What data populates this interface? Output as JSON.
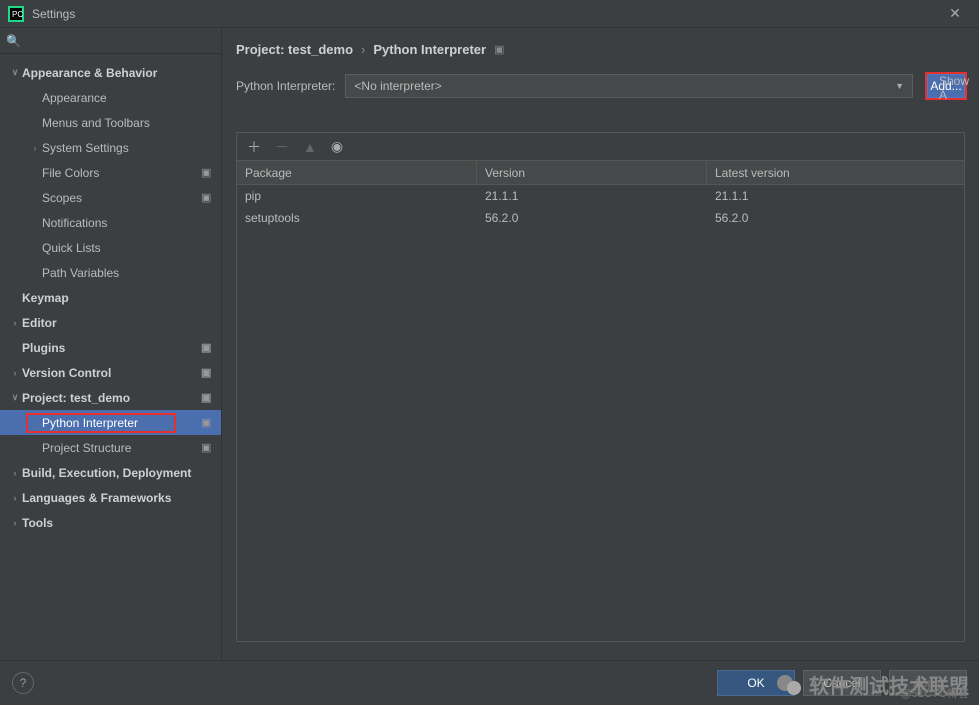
{
  "window": {
    "title": "Settings"
  },
  "search": {
    "placeholder": ""
  },
  "sidebar": [
    {
      "label": "Appearance & Behavior",
      "level": 0,
      "arrow": "∨",
      "badge": false
    },
    {
      "label": "Appearance",
      "level": 1,
      "arrow": "",
      "badge": false
    },
    {
      "label": "Menus and Toolbars",
      "level": 1,
      "arrow": "",
      "badge": false
    },
    {
      "label": "System Settings",
      "level": 1,
      "arrow": "›",
      "badge": false
    },
    {
      "label": "File Colors",
      "level": 1,
      "arrow": "",
      "badge": true
    },
    {
      "label": "Scopes",
      "level": 1,
      "arrow": "",
      "badge": true
    },
    {
      "label": "Notifications",
      "level": 1,
      "arrow": "",
      "badge": false
    },
    {
      "label": "Quick Lists",
      "level": 1,
      "arrow": "",
      "badge": false
    },
    {
      "label": "Path Variables",
      "level": 1,
      "arrow": "",
      "badge": false
    },
    {
      "label": "Keymap",
      "level": 0,
      "arrow": "",
      "badge": false
    },
    {
      "label": "Editor",
      "level": 0,
      "arrow": "›",
      "badge": false
    },
    {
      "label": "Plugins",
      "level": 0,
      "arrow": "",
      "badge": true
    },
    {
      "label": "Version Control",
      "level": 0,
      "arrow": "›",
      "badge": true
    },
    {
      "label": "Project: test_demo",
      "level": 0,
      "arrow": "∨",
      "badge": true
    },
    {
      "label": "Python Interpreter",
      "level": 2,
      "arrow": "",
      "badge": true,
      "selected": true,
      "redbox": true
    },
    {
      "label": "Project Structure",
      "level": 2,
      "arrow": "",
      "badge": true
    },
    {
      "label": "Build, Execution, Deployment",
      "level": 0,
      "arrow": "›",
      "badge": false
    },
    {
      "label": "Languages & Frameworks",
      "level": 0,
      "arrow": "›",
      "badge": false
    },
    {
      "label": "Tools",
      "level": 0,
      "arrow": "›",
      "badge": false
    }
  ],
  "breadcrumb": {
    "a": "Project: test_demo",
    "b": "Python Interpreter"
  },
  "interpreter": {
    "label": "Python Interpreter:",
    "value": "<No interpreter>"
  },
  "buttons": {
    "add": "Add...",
    "show": "Show A",
    "ok": "OK",
    "cancel": "Cancel",
    "apply": "Apply"
  },
  "packages": {
    "headers": {
      "package": "Package",
      "version": "Version",
      "latest": "Latest version"
    },
    "rows": [
      {
        "name": "pip",
        "version": "21.1.1",
        "latest": "21.1.1"
      },
      {
        "name": "setuptools",
        "version": "56.2.0",
        "latest": "56.2.0"
      }
    ]
  },
  "watermark": {
    "text": "软件测试技术联盟",
    "credit": "@51CTO博客"
  }
}
